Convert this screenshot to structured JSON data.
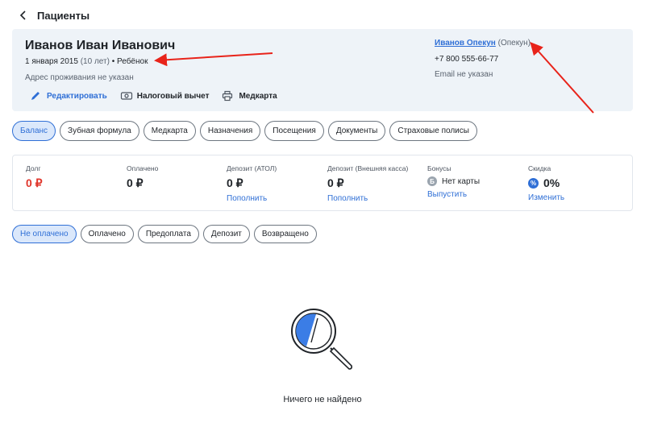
{
  "header": {
    "title": "Пациенты"
  },
  "patient": {
    "name": "Иванов Иван Иванович",
    "birth_date": "1 января 2015",
    "age": "(10 лет)",
    "separator": "•",
    "category": "Ребёнок",
    "address": "Адрес проживания не указан",
    "actions": {
      "edit": "Редактировать",
      "tax": "Налоговый вычет",
      "medcard": "Медкарта"
    }
  },
  "guardian": {
    "name": "Иванов Опекун",
    "role": "(Опекун)",
    "phone": "+7 800 555-66-77",
    "email": "Email не указан"
  },
  "tabs": [
    {
      "label": "Баланс",
      "active": true
    },
    {
      "label": "Зубная формула"
    },
    {
      "label": "Медкарта"
    },
    {
      "label": "Назначения"
    },
    {
      "label": "Посещения"
    },
    {
      "label": "Документы"
    },
    {
      "label": "Страховые полисы"
    }
  ],
  "balance": {
    "debt": {
      "label": "Долг",
      "value": "0 ₽"
    },
    "paid": {
      "label": "Оплачено",
      "value": "0 ₽"
    },
    "deposit_atol": {
      "label": "Депозит (АТОЛ)",
      "value": "0 ₽",
      "link": "Пополнить"
    },
    "deposit_external": {
      "label": "Депозит (Внешняя касса)",
      "value": "0 ₽",
      "link": "Пополнить"
    },
    "bonuses": {
      "label": "Бонусы",
      "value": "Нет карты",
      "link": "Выпустить"
    },
    "discount": {
      "label": "Скидка",
      "value": "0%",
      "link": "Изменить"
    }
  },
  "filters": [
    {
      "label": "Не оплачено",
      "active": true
    },
    {
      "label": "Оплачено"
    },
    {
      "label": "Предоплата"
    },
    {
      "label": "Депозит"
    },
    {
      "label": "Возвращено"
    }
  ],
  "empty": {
    "text": "Ничего не найдено"
  },
  "colors": {
    "accent": "#2f6fd6",
    "debt": "#e0352b",
    "card_bg": "#eef3f8",
    "annotation_arrow": "#e8231a"
  }
}
